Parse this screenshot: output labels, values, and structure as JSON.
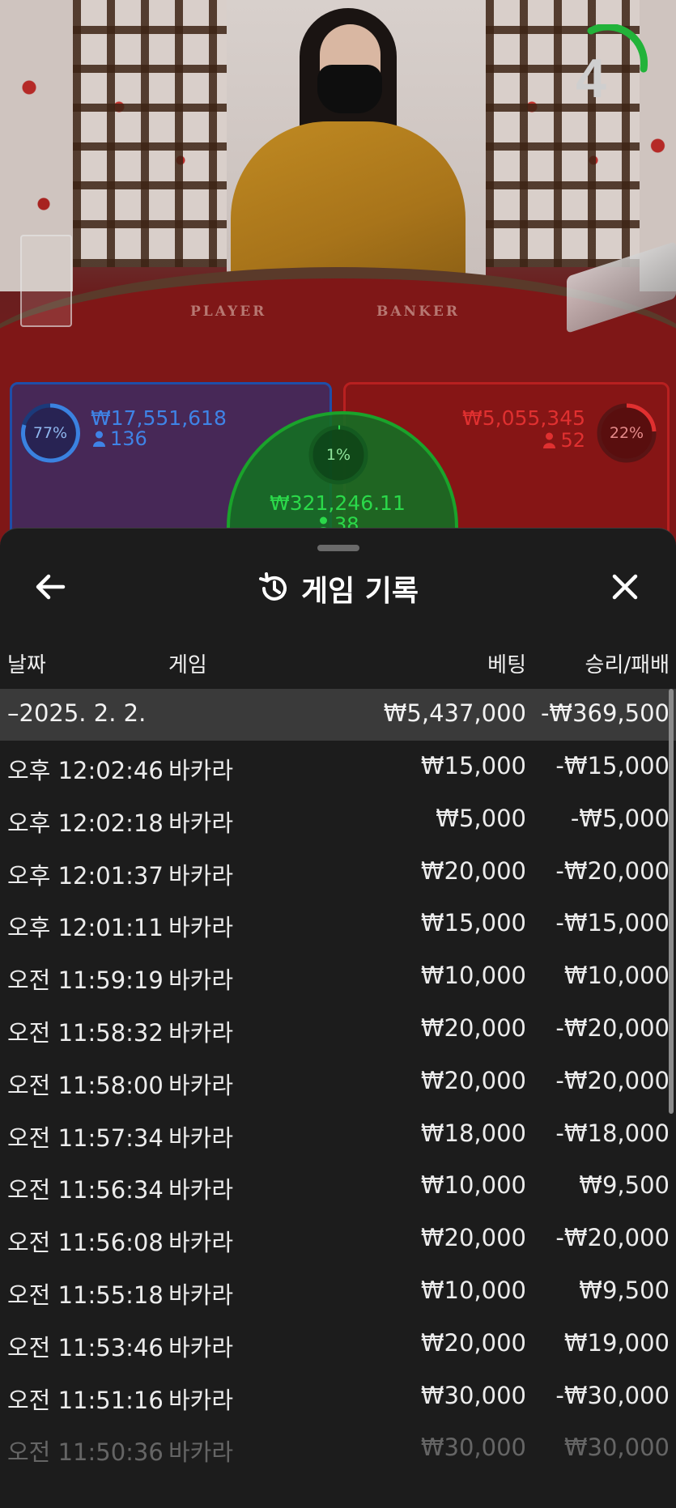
{
  "live": {
    "countdown": "4",
    "felt_player": "PLAYER",
    "felt_banker": "BANKER",
    "player": {
      "percent": "77%",
      "amount": "₩17,551,618",
      "players": "136",
      "color": "#2f6fd0"
    },
    "banker": {
      "percent": "22%",
      "amount": "₩5,055,345",
      "players": "52",
      "color": "#e03030"
    },
    "tie": {
      "percent": "1%",
      "amount": "₩321,246.11",
      "players": "38",
      "color": "#1aa32b"
    }
  },
  "sheet": {
    "title": "게임 기록",
    "icons": {
      "back": "arrow-left-icon",
      "history": "history-icon",
      "close": "close-icon"
    },
    "columns": {
      "date": "날짜",
      "game": "게임",
      "bet": "베팅",
      "result": "승리/패배"
    },
    "group": {
      "date": "–2025. 2. 2.",
      "bet": "₩5,437,000",
      "result": "-₩369,500"
    },
    "rows": [
      {
        "time": "오후 12:02:46",
        "game": "바카라",
        "bet": "₩15,000",
        "result": "-₩15,000"
      },
      {
        "time": "오후 12:02:18",
        "game": "바카라",
        "bet": "₩5,000",
        "result": "-₩5,000"
      },
      {
        "time": "오후 12:01:37",
        "game": "바카라",
        "bet": "₩20,000",
        "result": "-₩20,000"
      },
      {
        "time": "오후 12:01:11",
        "game": "바카라",
        "bet": "₩15,000",
        "result": "-₩15,000"
      },
      {
        "time": "오전 11:59:19",
        "game": "바카라",
        "bet": "₩10,000",
        "result": "₩10,000"
      },
      {
        "time": "오전 11:58:32",
        "game": "바카라",
        "bet": "₩20,000",
        "result": "-₩20,000"
      },
      {
        "time": "오전 11:58:00",
        "game": "바카라",
        "bet": "₩20,000",
        "result": "-₩20,000"
      },
      {
        "time": "오전 11:57:34",
        "game": "바카라",
        "bet": "₩18,000",
        "result": "-₩18,000"
      },
      {
        "time": "오전 11:56:34",
        "game": "바카라",
        "bet": "₩10,000",
        "result": "₩9,500"
      },
      {
        "time": "오전 11:56:08",
        "game": "바카라",
        "bet": "₩20,000",
        "result": "-₩20,000"
      },
      {
        "time": "오전 11:55:18",
        "game": "바카라",
        "bet": "₩10,000",
        "result": "₩9,500"
      },
      {
        "time": "오전 11:53:46",
        "game": "바카라",
        "bet": "₩20,000",
        "result": "₩19,000"
      },
      {
        "time": "오전 11:51:16",
        "game": "바카라",
        "bet": "₩30,000",
        "result": "-₩30,000"
      },
      {
        "time": "오전 11:50:36",
        "game": "바카라",
        "bet": "₩30,000",
        "result": "₩30,000"
      }
    ]
  }
}
